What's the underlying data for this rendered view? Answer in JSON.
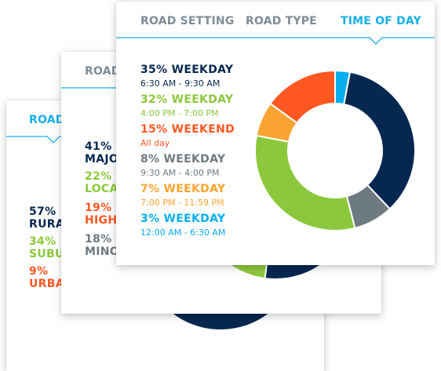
{
  "colors": {
    "navy": "#062850",
    "green": "#8cc83c",
    "orange": "#ff5722",
    "gray": "#6e7a81",
    "amber": "#f9a431",
    "cyan": "#06aef0",
    "tab_inactive": "#7f8c97",
    "tab_active": "#17b0e6"
  },
  "card1": {
    "tab_label": "ROAD",
    "legend": [
      {
        "pct": "57%",
        "label": "RURAL"
      },
      {
        "pct": "34%",
        "label": "SUBURBAN"
      },
      {
        "pct": "9%",
        "label": "URBAN"
      }
    ]
  },
  "card2": {
    "tab_label": "ROAD",
    "legend": [
      {
        "pct": "41%",
        "label": "MAJOR"
      },
      {
        "pct": "22%",
        "label": "LOCAL"
      },
      {
        "pct": "19%",
        "label": "HIGHWAY"
      },
      {
        "pct": "18%",
        "label": "MINOR"
      }
    ]
  },
  "card3": {
    "tabs": [
      {
        "label": "ROAD SETTING"
      },
      {
        "label": "ROAD TYPE"
      },
      {
        "label": "TIME OF DAY"
      }
    ]
  },
  "chart_data": [
    {
      "type": "pie",
      "categories": [
        "WEEKDAY",
        "WEEKDAY",
        "WEEKEND",
        "WEEKDAY",
        "WEEKDAY",
        "WEEKDAY"
      ],
      "series": [
        {
          "name": "WEEKDAY",
          "value": 35,
          "label": "35% WEEKDAY",
          "sub": "6:30 AM - 9:30 AM",
          "color": "#062850"
        },
        {
          "name": "WEEKDAY",
          "value": 32,
          "label": "32% WEEKDAY",
          "sub": "4:00 PM - 7:00 PM",
          "color": "#8cc83c"
        },
        {
          "name": "WEEKEND",
          "value": 15,
          "label": "15% WEEKEND",
          "sub": "All day",
          "color": "#ff5722"
        },
        {
          "name": "WEEKDAY",
          "value": 8,
          "label": "8% WEEKDAY",
          "sub": "9:30 AM - 4:00 PM",
          "color": "#6e7a81"
        },
        {
          "name": "WEEKDAY",
          "value": 7,
          "label": "7% WEEKDAY",
          "sub": "7:00 PM - 11:59 PM",
          "color": "#f9a431"
        },
        {
          "name": "WEEKDAY",
          "value": 3,
          "label": "3% WEEKDAY",
          "sub": "12:00 AM - 6:30 AM",
          "color": "#06aef0"
        }
      ],
      "ring_order": [
        5,
        0,
        3,
        1,
        4,
        2
      ]
    },
    {
      "type": "pie",
      "series": [
        {
          "name": "MAJOR",
          "value": 41,
          "color": "#062850"
        },
        {
          "name": "LOCAL",
          "value": 22,
          "color": "#8cc83c"
        },
        {
          "name": "HIGHWAY",
          "value": 19,
          "color": "#ff5722"
        },
        {
          "name": "MINOR",
          "value": 18,
          "color": "#6e7a81"
        }
      ]
    },
    {
      "type": "pie",
      "series": [
        {
          "name": "RURAL",
          "value": 57,
          "color": "#062850"
        },
        {
          "name": "SUBURBAN",
          "value": 34,
          "color": "#8cc83c"
        },
        {
          "name": "URBAN",
          "value": 9,
          "color": "#ff5722"
        }
      ]
    }
  ]
}
